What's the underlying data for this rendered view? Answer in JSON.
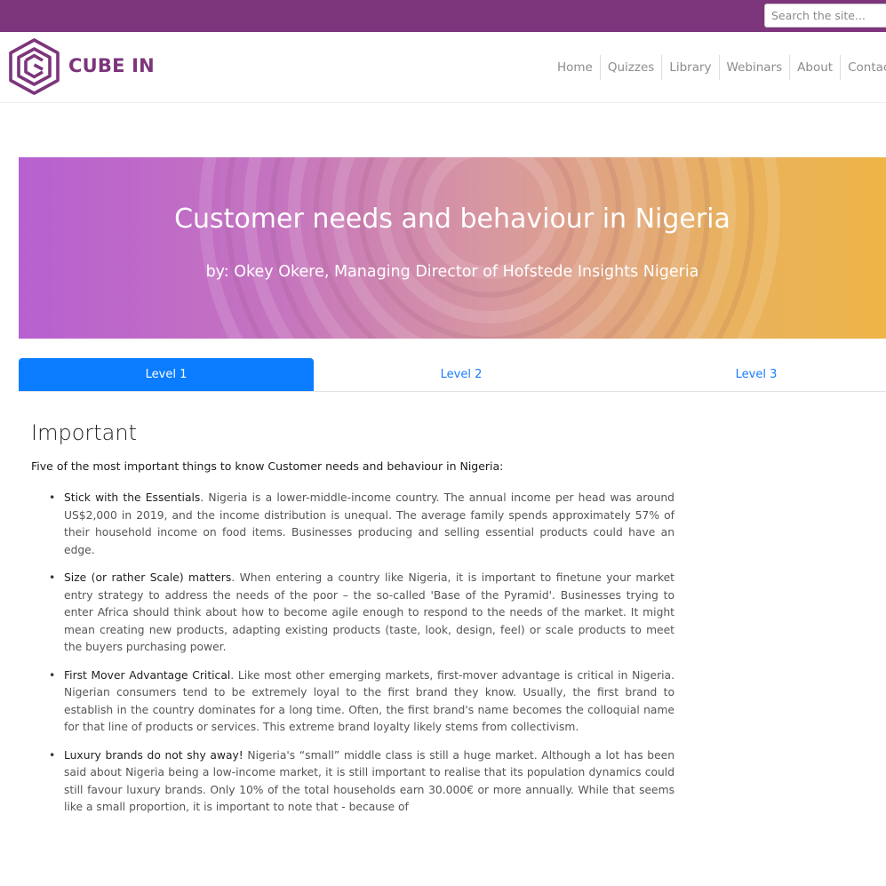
{
  "search": {
    "placeholder": "Search the site..."
  },
  "brand": {
    "name": "CUBE IN",
    "color": "#7d357c",
    "logo_icon": "cube-hexagon-logo"
  },
  "nav": {
    "items": [
      "Home",
      "Quizzes",
      "Library",
      "Webinars",
      "About",
      "Contact"
    ]
  },
  "hero": {
    "title": "Customer needs and behaviour in Nigeria",
    "subtitle": "by: Okey Okere, Managing Director of Hofstede Insights Nigeria"
  },
  "tabs": [
    {
      "label": "Level 1",
      "active": true
    },
    {
      "label": "Level 2",
      "active": false
    },
    {
      "label": "Level 3",
      "active": false
    }
  ],
  "content": {
    "heading": "Important",
    "intro": "Five of the most important things to know Customer needs and behaviour in Nigeria:",
    "points": [
      {
        "title": "Stick with the Essentials",
        "text": ". Nigeria is a lower-middle-income country. The annual income per head was around US$2,000 in 2019, and the income distribution is unequal. The average family spends approximately 57% of their household income on food items. Businesses producing and selling essential products could have an edge."
      },
      {
        "title": "Size (or rather Scale) matters",
        "text": ". When entering a country like Nigeria, it is important to finetune your market entry strategy to address the needs of the poor – the so-called 'Base of the Pyramid'. Businesses trying to enter Africa should think about how to become agile enough to respond to the needs of the market. It might mean creating new products, adapting existing products (taste, look, design, feel) or scale products to meet the buyers purchasing power."
      },
      {
        "title": "First Mover Advantage Critical",
        "text": ". Like most other emerging markets, first-mover advantage is critical in Nigeria. Nigerian consumers tend to be extremely loyal to the first brand they know. Usually, the first brand to establish in the country dominates for a long time. Often, the first brand's name becomes the colloquial name for that line of products or services. This extreme brand loyalty likely stems from collectivism."
      },
      {
        "title": "Luxury brands do not shy away!",
        "text": " Nigeria's “small” middle class is still a huge market. Although a lot has been said about Nigeria being a low-income market, it is still important to realise that its population dynamics could still favour luxury brands. Only 10% of the total households earn 30.000€ or more annually. While that seems like a small proportion, it is important to note that - because of"
      }
    ]
  },
  "colors": {
    "topbar": "#7d357c",
    "active_tab": "#0a7cff",
    "tab_link": "#1a7dff",
    "hero_gradient_start": "#b760d0",
    "hero_gradient_end": "#eeb447"
  }
}
